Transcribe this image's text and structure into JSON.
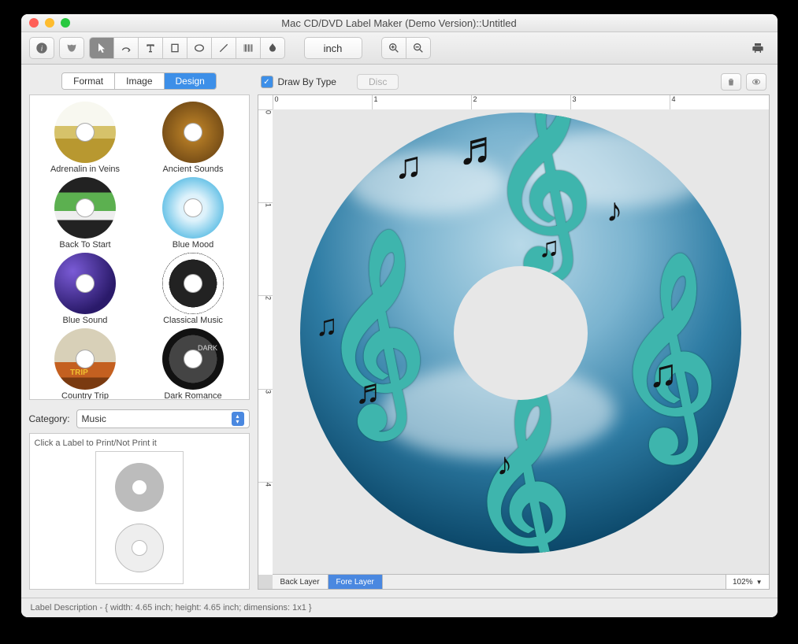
{
  "window": {
    "title": "Mac CD/DVD Label Maker (Demo Version)::Untitled"
  },
  "toolbar": {
    "unit_label": "inch"
  },
  "sidebar": {
    "tabs": {
      "format": "Format",
      "image": "Image",
      "design": "Design"
    },
    "templates": [
      {
        "label": "Adrenalin in Veins"
      },
      {
        "label": "Ancient Sounds"
      },
      {
        "label": "Back To Start"
      },
      {
        "label": "Blue Mood"
      },
      {
        "label": "Blue Sound"
      },
      {
        "label": "Classical Music"
      },
      {
        "label": "Country Trip"
      },
      {
        "label": "Dark Romance"
      }
    ],
    "category_label": "Category:",
    "category_value": "Music",
    "print_hint": "Click a Label to Print/Not Print it"
  },
  "main": {
    "draw_by_type_label": "Draw By Type",
    "disc_button": "Disc",
    "layers": {
      "back": "Back Layer",
      "fore": "Fore Layer"
    },
    "zoom": "102%",
    "ruler": [
      "0",
      "1",
      "2",
      "3",
      "4"
    ]
  },
  "status": {
    "text": "Label Description - { width: 4.65 inch; height: 4.65 inch; dimensions: 1x1 }"
  }
}
